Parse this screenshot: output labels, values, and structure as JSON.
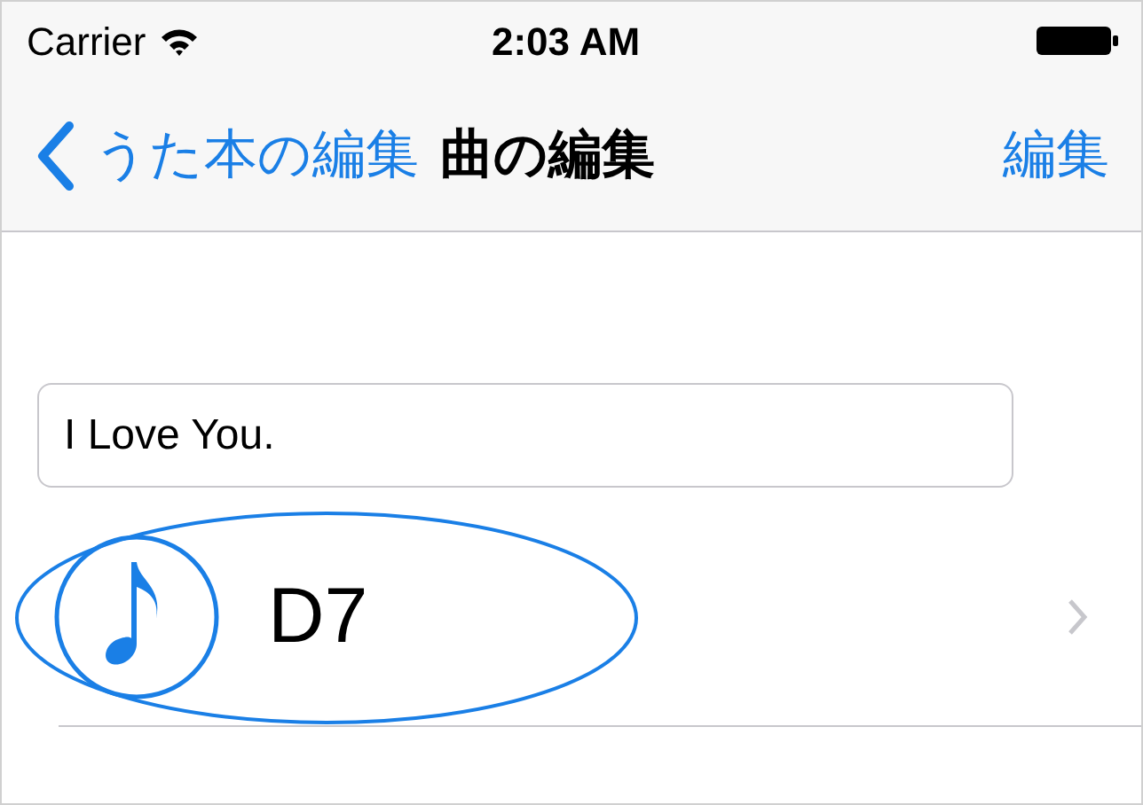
{
  "status_bar": {
    "carrier": "Carrier",
    "time": "2:03 AM"
  },
  "nav_bar": {
    "back_label": "うた本の編集",
    "title": "曲の編集",
    "action": "編集"
  },
  "title_field": {
    "value": "I Love You."
  },
  "rows": [
    {
      "label": "D7"
    }
  ]
}
